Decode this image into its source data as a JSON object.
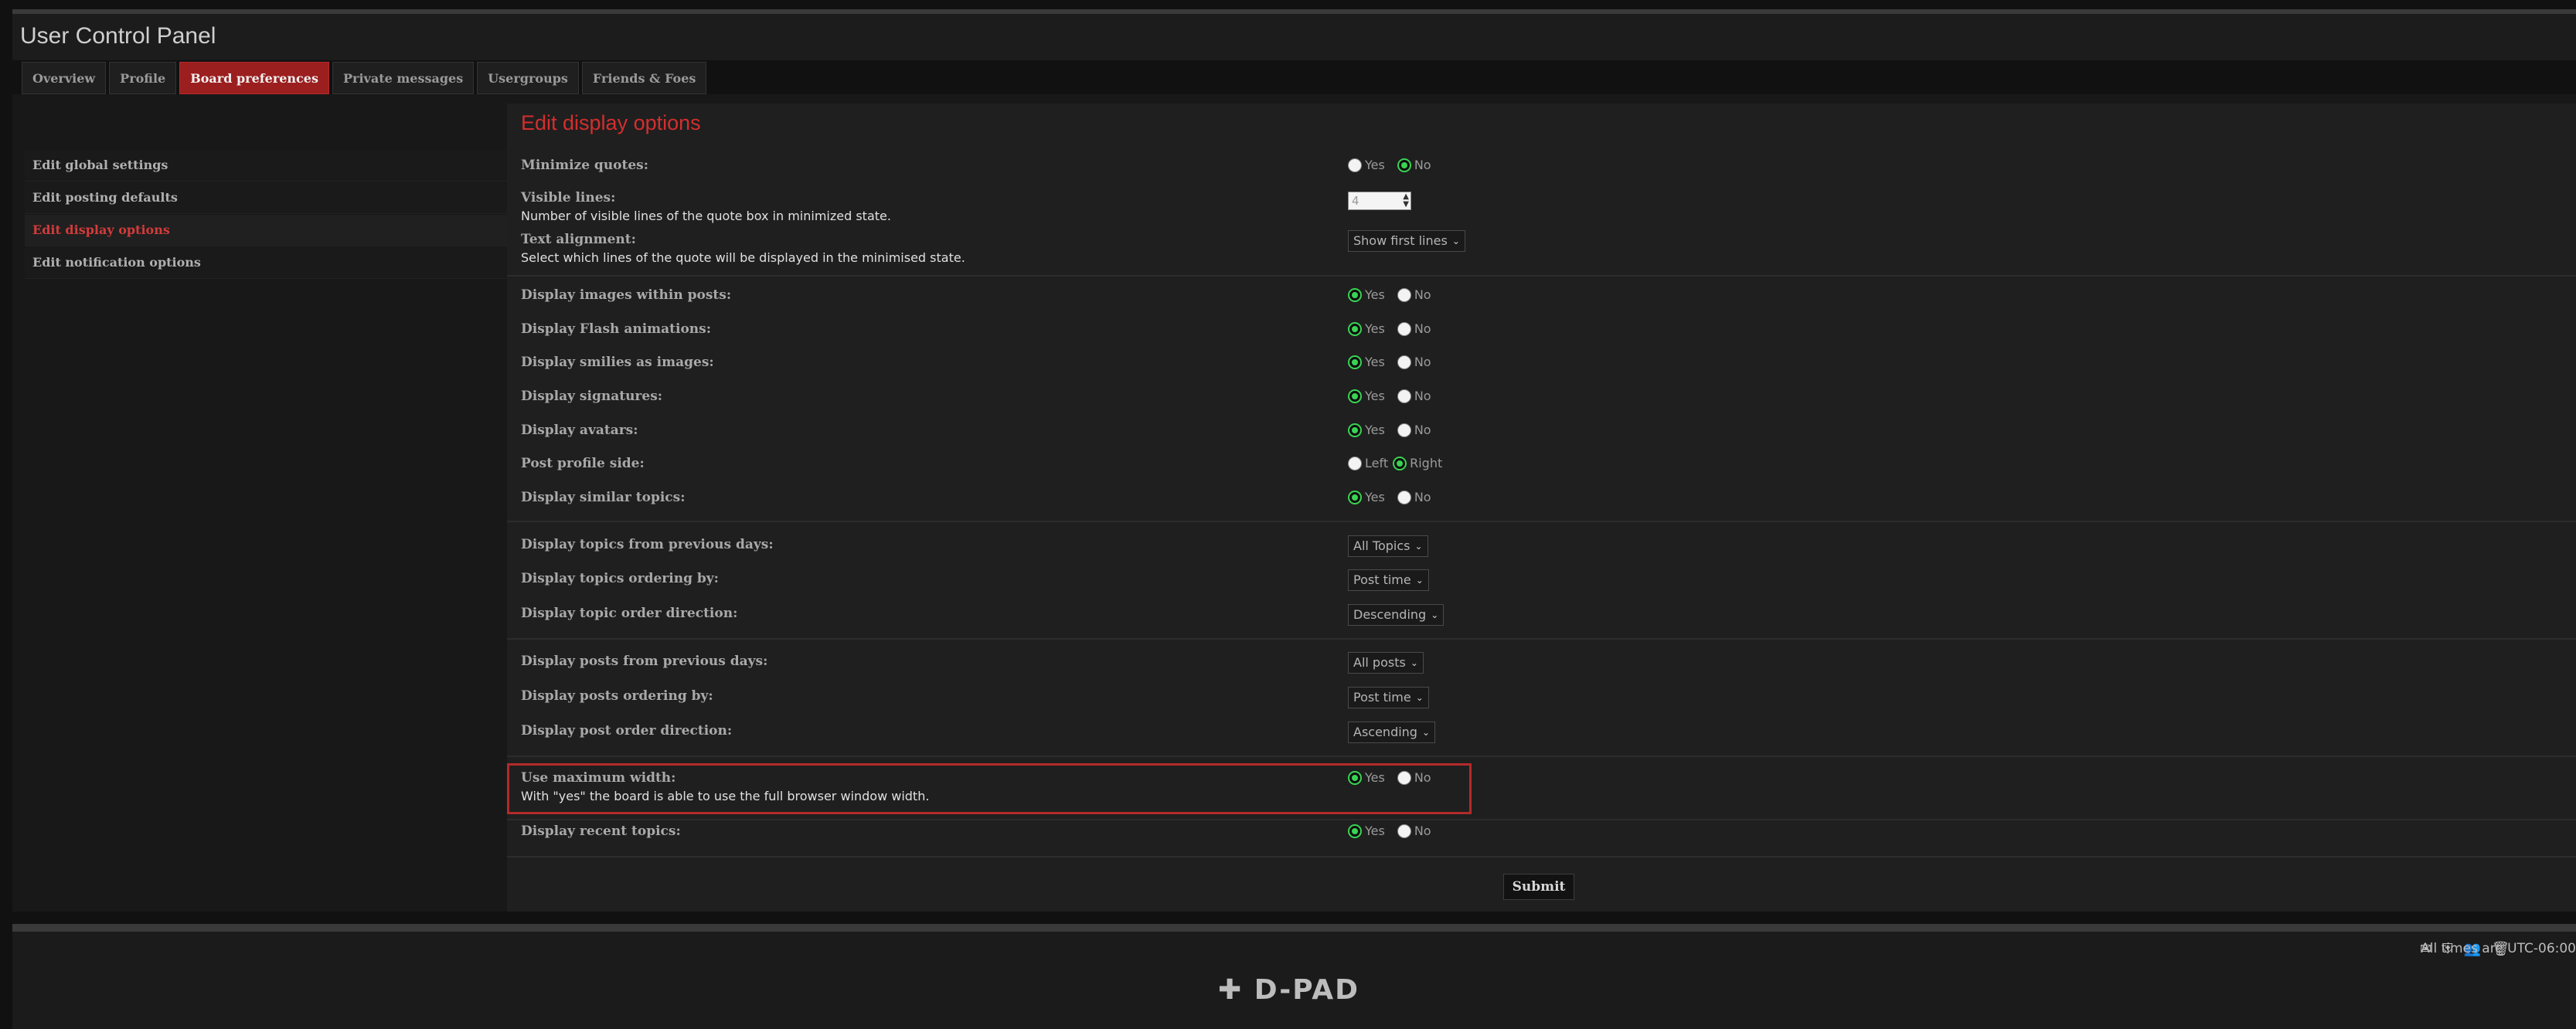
{
  "header": {
    "title": "User Control Panel"
  },
  "tabs": [
    {
      "label": "Overview"
    },
    {
      "label": "Profile"
    },
    {
      "label": "Board preferences"
    },
    {
      "label": "Private messages"
    },
    {
      "label": "Usergroups"
    },
    {
      "label": "Friends & Foes"
    }
  ],
  "sidebar": {
    "items": [
      {
        "label": "Edit global settings"
      },
      {
        "label": "Edit posting defaults"
      },
      {
        "label": "Edit display options"
      },
      {
        "label": "Edit notification options"
      }
    ]
  },
  "main": {
    "title": "Edit display options",
    "minimize_quotes": {
      "label": "Minimize quotes:",
      "yes": "Yes",
      "no": "No",
      "selected": "No"
    },
    "visible_lines": {
      "label": "Visible lines:",
      "explain": "Number of visible lines of the quote box in minimized state.",
      "value": "4"
    },
    "text_alignment": {
      "label": "Text alignment:",
      "explain": "Select which lines of the quote will be displayed in the minimised state.",
      "value": "Show first lines"
    },
    "display_images": {
      "label": "Display images within posts:",
      "yes": "Yes",
      "no": "No",
      "selected": "Yes"
    },
    "display_flash": {
      "label": "Display Flash animations:",
      "yes": "Yes",
      "no": "No",
      "selected": "Yes"
    },
    "display_smilies": {
      "label": "Display smilies as images:",
      "yes": "Yes",
      "no": "No",
      "selected": "Yes"
    },
    "display_signatures": {
      "label": "Display signatures:",
      "yes": "Yes",
      "no": "No",
      "selected": "Yes"
    },
    "display_avatars": {
      "label": "Display avatars:",
      "yes": "Yes",
      "no": "No",
      "selected": "Yes"
    },
    "post_profile_side": {
      "label": "Post profile side:",
      "left": "Left",
      "right": "Right",
      "selected": "Right"
    },
    "display_similar": {
      "label": "Display similar topics:",
      "yes": "Yes",
      "no": "No",
      "selected": "Yes"
    },
    "topics_previous_days": {
      "label": "Display topics from previous days:",
      "value": "All Topics"
    },
    "topics_ordering": {
      "label": "Display topics ordering by:",
      "value": "Post time"
    },
    "topic_order_direction": {
      "label": "Display topic order direction:",
      "value": "Descending"
    },
    "posts_previous_days": {
      "label": "Display posts from previous days:",
      "value": "All posts"
    },
    "posts_ordering": {
      "label": "Display posts ordering by:",
      "value": "Post time"
    },
    "post_order_direction": {
      "label": "Display post order direction:",
      "value": "Ascending"
    },
    "max_width": {
      "label": "Use maximum width:",
      "explain": "With \"yes\" the board is able to use the full browser window width.",
      "yes": "Yes",
      "no": "No",
      "selected": "Yes"
    },
    "recent_topics": {
      "label": "Display recent topics:",
      "yes": "Yes",
      "no": "No",
      "selected": "Yes"
    },
    "submit": "Submit"
  },
  "footer": {
    "timezone": "All times are UTC-06:00",
    "logo": "D-PAD",
    "icons": [
      "envelope-icon",
      "shield-icon",
      "users-icon",
      "trash-icon"
    ]
  },
  "colors": {
    "accent": "#d42e2e",
    "active_tab": "#9c1f1f",
    "radio_on": "#39d353"
  }
}
